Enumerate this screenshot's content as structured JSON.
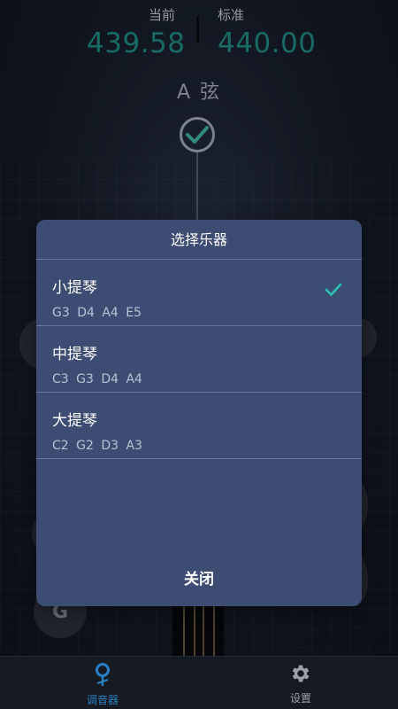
{
  "tuner": {
    "current_label": "当前",
    "current_value": "439.58",
    "standard_label": "标准",
    "standard_value": "440.00",
    "string_name": "A 弦"
  },
  "pegs": {
    "g_label": "G"
  },
  "dialog": {
    "title": "选择乐器",
    "instruments": [
      {
        "name": "小提琴",
        "notes": "G3 D4 A4 E5",
        "selected": true
      },
      {
        "name": "中提琴",
        "notes": "C3 G3 D4 A4",
        "selected": false
      },
      {
        "name": "大提琴",
        "notes": "C2 G2 D3 A3",
        "selected": false
      }
    ],
    "close_label": "关闭"
  },
  "tabbar": {
    "tabs": [
      {
        "label": "调音器",
        "icon": "tuner-pin-icon",
        "active": true
      },
      {
        "label": "设置",
        "icon": "gear-icon",
        "active": false
      }
    ]
  },
  "colors": {
    "accent": "#1f8f86",
    "dialog_bg": "#3d4c72",
    "check": "#28c4b0",
    "tab_active": "#2a7fc1"
  }
}
